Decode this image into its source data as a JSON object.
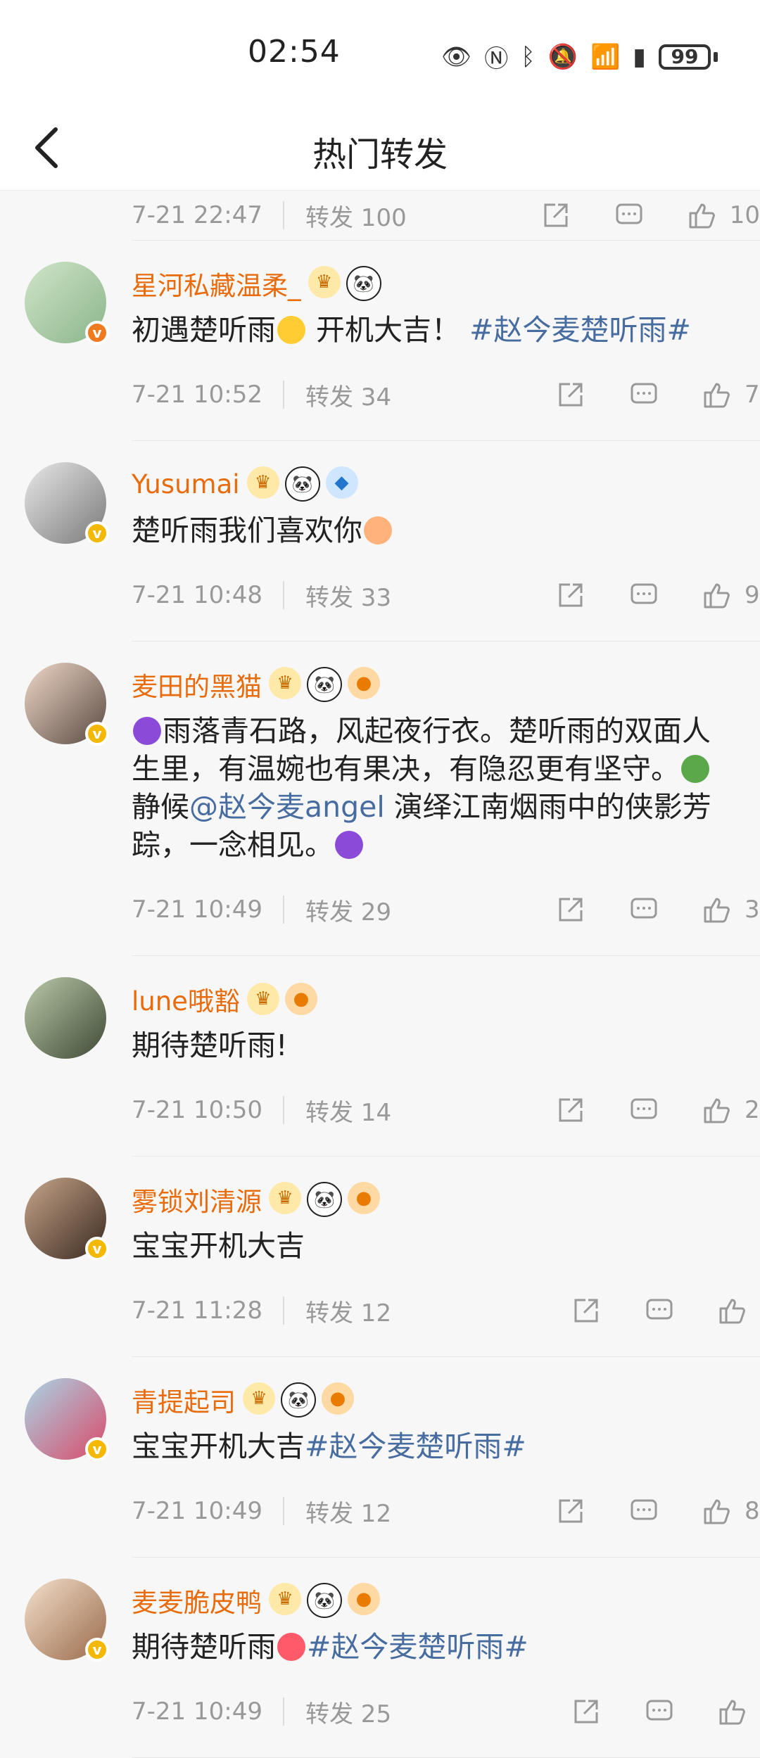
{
  "status": {
    "time": "02:54",
    "battery": "99"
  },
  "header": {
    "title": "热门转发"
  },
  "top_partial": {
    "time": "7-21 22:47",
    "repost": "转发 100",
    "likes": "10"
  },
  "items": [
    {
      "name": "星河私藏温柔_",
      "text": "初遇楚听雨",
      "text2": " 开机大吉！",
      "tag": "#赵今麦楚听雨#",
      "time": "7-21 10:52",
      "repost": "转发 34",
      "likes": "7"
    },
    {
      "name": "Yusumai",
      "text": "楚听雨我们喜欢你",
      "time": "7-21 10:48",
      "repost": "转发 33",
      "likes": "9"
    },
    {
      "name": "麦田的黑猫",
      "text_a": "雨落青石路，风起夜行衣。楚听雨的双面人生里，有温婉也有果决，有隐忍更有坚守。",
      "text_b": "静候",
      "mention": "@赵今麦angel",
      "text_c": " 演绎江南烟雨中的侠影芳踪，一念相见。",
      "time": "7-21 10:49",
      "repost": "转发 29",
      "likes": "3"
    },
    {
      "name": "lune哦豁",
      "text": "期待楚听雨!",
      "time": "7-21 10:50",
      "repost": "转发 14",
      "likes": "2"
    },
    {
      "name": "雾锁刘清源",
      "text": "宝宝开机大吉",
      "time": "7-21 11:28",
      "repost": "转发 12",
      "likes": ""
    },
    {
      "name": "青提起司",
      "text": "宝宝开机大吉",
      "tag": "#赵今麦楚听雨#",
      "time": "7-21 10:49",
      "repost": "转发 12",
      "likes": "8"
    },
    {
      "name": "麦麦脆皮鸭",
      "text": "期待楚听雨",
      "tag": "#赵今麦楚听雨#",
      "time": "7-21 10:49",
      "repost": "转发 25",
      "likes": ""
    }
  ]
}
